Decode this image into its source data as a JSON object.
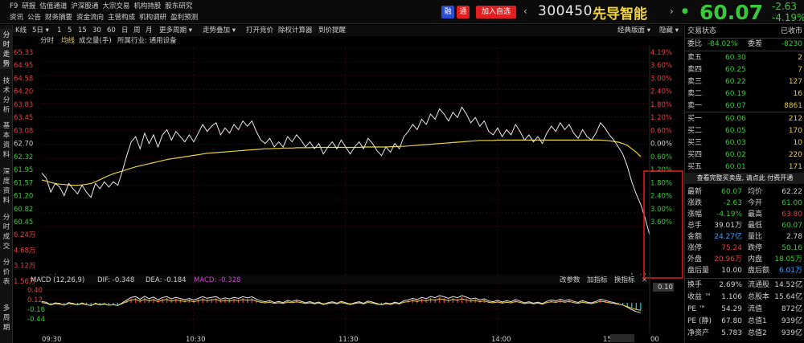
{
  "topbar": {
    "menu_row1": [
      "F9",
      "研报",
      "估值通道",
      "沪深股通",
      "大宗交易",
      "机构持股",
      "股东研究"
    ],
    "menu_row2": [
      "资讯",
      "公告",
      "财务摘要",
      "资金流向",
      "主营构成",
      "机构调研",
      "盈利预测"
    ],
    "btn_rong": "融",
    "btn_tong": "通",
    "btn_add": "加入自选",
    "code": "300450",
    "name": "先导智能",
    "price": "60.07",
    "change": "-2.63",
    "change_pct": "-4.19%",
    "colors": {
      "red": "#e02020",
      "green": "#39c839",
      "yellow": "#f0d23c",
      "blue": "#2a4fd6"
    }
  },
  "left_tabs": [
    "分时走势",
    "技术分析",
    "基本资料",
    "深度资料",
    "分时成交",
    "分价表",
    "多周期"
  ],
  "toolbar": {
    "kline": "K线",
    "periods": [
      "5日",
      "1",
      "5",
      "15",
      "30",
      "60",
      "日",
      "周",
      "月"
    ],
    "more_period": "更多周期",
    "overlay": "走势叠加",
    "restore": "打开竞价",
    "calc": "除权计算器",
    "tip": "到价提醒",
    "classic": "经典版面",
    "hide": "隐藏"
  },
  "subbar": {
    "fenshi": "分时",
    "junxian": "均线",
    "volume": "成交量(手)",
    "industry": "所属行业: 通用设备"
  },
  "chart_data": {
    "type": "line",
    "price_axis_left": [
      "65.33",
      "64.95",
      "64.58",
      "64.20",
      "63.83",
      "63.45",
      "63.08",
      "62.70",
      "62.32",
      "61.95",
      "61.57",
      "61.20",
      "60.82",
      "60.45"
    ],
    "pct_axis_right": [
      "4.19%",
      "3.60%",
      "3.00%",
      "2.40%",
      "1.80%",
      "1.20%",
      "0.60%",
      "0.00%",
      "0.60%",
      "1.20%",
      "1.80%",
      "2.40%",
      "3.00%",
      "3.60%"
    ],
    "prev_close": 62.7,
    "ylim": [
      60.07,
      65.33
    ],
    "volume_axis": [
      "6.24万",
      "4.68万",
      "3.12万",
      "1.56万"
    ],
    "macd_label": "MACD (12,26,9)",
    "dif": "DIF: -0.348",
    "dea": "DEA: -0.184",
    "macd": "MACD: -0.328",
    "macd_axis": [
      "0.40",
      "0.12",
      "-0.16",
      "-0.44"
    ],
    "macd_right_value": "0.10",
    "macd_buttons": [
      "改参数",
      "加指标",
      "换指标"
    ],
    "x_ticks": [
      "09:30",
      "10:30",
      "11:30",
      "14:00",
      "15:00"
    ],
    "x_end_label": "00",
    "series": [
      {
        "values": [
          61.85,
          61.7,
          61.3,
          61.55,
          61.45,
          61.2,
          61.55,
          61.4,
          61.25,
          61.5,
          61.3,
          61.15,
          61.55,
          61.4,
          61.6,
          61.45,
          61.6,
          61.5,
          61.9,
          62.35,
          62.75,
          62.9,
          62.55,
          63.0,
          62.7,
          62.95,
          62.6,
          62.95,
          63.1,
          62.8,
          63.05,
          62.9,
          62.75,
          62.95,
          62.75,
          63.0,
          63.25,
          63.05,
          63.2,
          63.3,
          62.95,
          63.15,
          63.0,
          63.25,
          63.1,
          63.35,
          63.2,
          63.35,
          63.05,
          62.8,
          62.7,
          62.85,
          62.6,
          62.75,
          62.6,
          62.9,
          62.75,
          62.95,
          62.8,
          62.6,
          62.75,
          62.55,
          62.7,
          62.4,
          62.6,
          62.75,
          62.55,
          62.8,
          62.6,
          62.4,
          62.6,
          62.75,
          62.55,
          62.85,
          62.7,
          62.5,
          62.35,
          62.6,
          62.45,
          62.7,
          62.55,
          62.9,
          63.05,
          63.25,
          63.1,
          63.4,
          63.25,
          63.55,
          63.4,
          63.7,
          63.55,
          63.35,
          63.6,
          63.45,
          63.75,
          63.55,
          63.3,
          63.45,
          63.2,
          63.35,
          63.05,
          62.95,
          63.15,
          62.9,
          63.1,
          62.95,
          63.25,
          63.05,
          62.8,
          62.95,
          62.75,
          62.9,
          62.7,
          63.0,
          63.2,
          63.05,
          63.3,
          63.1,
          63.25,
          63.0,
          62.85,
          63.1,
          62.9,
          62.8,
          63.0,
          63.3,
          63.15,
          62.95,
          62.8,
          62.6,
          62.4,
          62.05,
          61.6,
          61.25,
          60.95,
          60.55,
          60.07
        ]
      },
      {
        "values": [
          61.65,
          61.62,
          61.58,
          61.55,
          61.53,
          61.52,
          61.51,
          61.5,
          61.5,
          61.51,
          61.53,
          61.55,
          61.6,
          61.66,
          61.72,
          61.78,
          61.83,
          61.87,
          61.91,
          61.95,
          61.99,
          62.03,
          62.06,
          62.09,
          62.12,
          62.15,
          62.18,
          62.21,
          62.24,
          62.26,
          62.28,
          62.3,
          62.32,
          62.34,
          62.36,
          62.38,
          62.4,
          62.42,
          62.43,
          62.44,
          62.45,
          62.46,
          62.47,
          62.48,
          62.49,
          62.5,
          62.51,
          62.52,
          62.53,
          62.54,
          62.55,
          62.55,
          62.56,
          62.56,
          62.57,
          62.57,
          62.57,
          62.58,
          62.58,
          62.58,
          62.58,
          62.59,
          62.59,
          62.59,
          62.59,
          62.59,
          62.59,
          62.59,
          62.59,
          62.59,
          62.59,
          62.59,
          62.6,
          62.6,
          62.6,
          62.6,
          62.6,
          62.6,
          62.61,
          62.61,
          62.62,
          62.62,
          62.63,
          62.64,
          62.65,
          62.66,
          62.67,
          62.68,
          62.69,
          62.7,
          62.71,
          62.72,
          62.73,
          62.74,
          62.75,
          62.76,
          62.77,
          62.78,
          62.79,
          62.79,
          62.79,
          62.79,
          62.8,
          62.8,
          62.8,
          62.8,
          62.8,
          62.8,
          62.8,
          62.8,
          62.8,
          62.8,
          62.8,
          62.8,
          62.8,
          62.8,
          62.8,
          62.8,
          62.8,
          62.8,
          62.8,
          62.8,
          62.8,
          62.8,
          62.8,
          62.8,
          62.79,
          62.78,
          62.76,
          62.74,
          62.7,
          62.65,
          62.55,
          62.45,
          62.32
        ]
      }
    ]
  },
  "quote_panel": {
    "title": "交易状态",
    "status": "已收市",
    "weibi_label": "委比",
    "weibi_val": "-84.02%",
    "weicha_label": "委差",
    "weicha_val": "-8230",
    "asks": [
      {
        "label": "卖五",
        "price": "60.30",
        "vol": "2"
      },
      {
        "label": "卖四",
        "price": "60.25",
        "vol": "7"
      },
      {
        "label": "卖三",
        "price": "60.22",
        "vol": "127"
      },
      {
        "label": "卖二",
        "price": "60.19",
        "vol": "16"
      },
      {
        "label": "卖一",
        "price": "60.07",
        "vol": "8861"
      }
    ],
    "bids": [
      {
        "label": "买一",
        "price": "60.06",
        "vol": "212"
      },
      {
        "label": "买二",
        "price": "60.05",
        "vol": "170"
      },
      {
        "label": "买三",
        "price": "60.03",
        "vol": "10"
      },
      {
        "label": "买四",
        "price": "60.02",
        "vol": "220"
      },
      {
        "label": "买五",
        "price": "60.01",
        "vol": "171"
      }
    ],
    "more_link": "查看完整买卖盘, 请点此 付费开通",
    "stats": [
      {
        "l1": "最新",
        "v1": "60.07",
        "l2": "均价",
        "v2": "62.22"
      },
      {
        "l1": "涨跌",
        "v1": "-2.63",
        "l2": "今开",
        "v2": "61.00"
      },
      {
        "l1": "涨幅",
        "v1": "-4.19%",
        "l2": "最高",
        "v2": "63.80"
      },
      {
        "l1": "总手",
        "v1": "39.01万",
        "l2": "最低",
        "v2": "60.07"
      },
      {
        "l1": "金额",
        "v1": "24.27亿",
        "l2": "量比",
        "v2": "2.78"
      },
      {
        "l1": "涨停",
        "v1": "75.24",
        "l2": "跌停",
        "v2": "50.16"
      },
      {
        "l1": "外盘",
        "v1": "20.96万",
        "l2": "内盘",
        "v2": "18.05万"
      },
      {
        "l1": "盘后量",
        "v1": "10.00",
        "l2": "盘后额",
        "v2": "6.01万"
      }
    ],
    "fundamentals": [
      {
        "l1": "换手",
        "v1": "2.69%",
        "l2": "流通股",
        "v2": "14.52亿"
      },
      {
        "l1": "收益 ™",
        "v1": "1.106",
        "l2": "总股本",
        "v2": "15.64亿"
      },
      {
        "l1": "PE ™",
        "v1": "54.29",
        "l2": "流值",
        "v2": "872亿"
      },
      {
        "l1": "PE (静)",
        "v1": "67.80",
        "l2": "总值1",
        "v2": "939亿"
      },
      {
        "l1": "净资产",
        "v1": "5.783",
        "l2": "总值2",
        "v2": "939亿"
      }
    ]
  }
}
